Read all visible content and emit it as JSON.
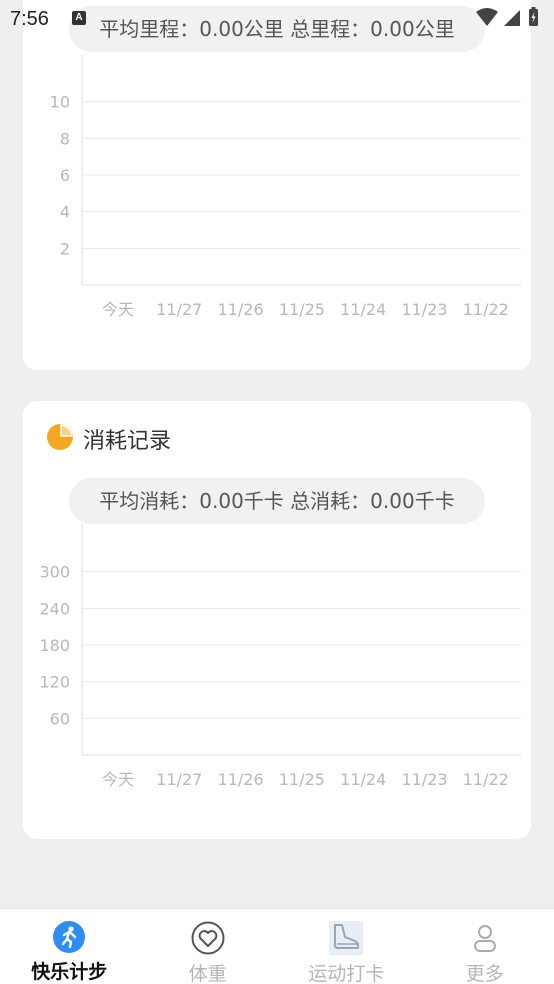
{
  "status_bar": {
    "time": "7:56",
    "notification_icon": "A"
  },
  "mileage_card": {
    "summary": "平均里程：0.00公里  总里程：0.00公里",
    "chart_data": {
      "type": "bar",
      "categories": [
        "今天",
        "11/27",
        "11/26",
        "11/25",
        "11/24",
        "11/23",
        "11/22"
      ],
      "values": [
        0,
        0,
        0,
        0,
        0,
        0,
        0
      ],
      "yticks": [
        "2",
        "4",
        "6",
        "8",
        "10"
      ],
      "title": "",
      "xlabel": "",
      "ylabel": "",
      "ylim": [
        0,
        12
      ],
      "grid": true
    }
  },
  "calorie_card": {
    "title": "消耗记录",
    "icon": "pie-chart-icon",
    "accent": "#f5a623",
    "summary": "平均消耗：0.00千卡 总消耗：0.00千卡",
    "chart_data": {
      "type": "bar",
      "categories": [
        "今天",
        "11/27",
        "11/26",
        "11/25",
        "11/24",
        "11/23",
        "11/22"
      ],
      "values": [
        0,
        0,
        0,
        0,
        0,
        0,
        0
      ],
      "yticks": [
        "60",
        "120",
        "180",
        "240",
        "300"
      ],
      "title": "",
      "xlabel": "",
      "ylabel": "",
      "ylim": [
        0,
        360
      ],
      "grid": true
    }
  },
  "bottom_nav": {
    "items": [
      {
        "label": "快乐计步",
        "icon": "runner-icon",
        "active": true
      },
      {
        "label": "体重",
        "icon": "heart-icon",
        "active": false
      },
      {
        "label": "运动打卡",
        "icon": "shoe-icon",
        "active": false
      },
      {
        "label": "更多",
        "icon": "person-icon",
        "active": false
      }
    ],
    "accent": "#2f8cf0"
  }
}
